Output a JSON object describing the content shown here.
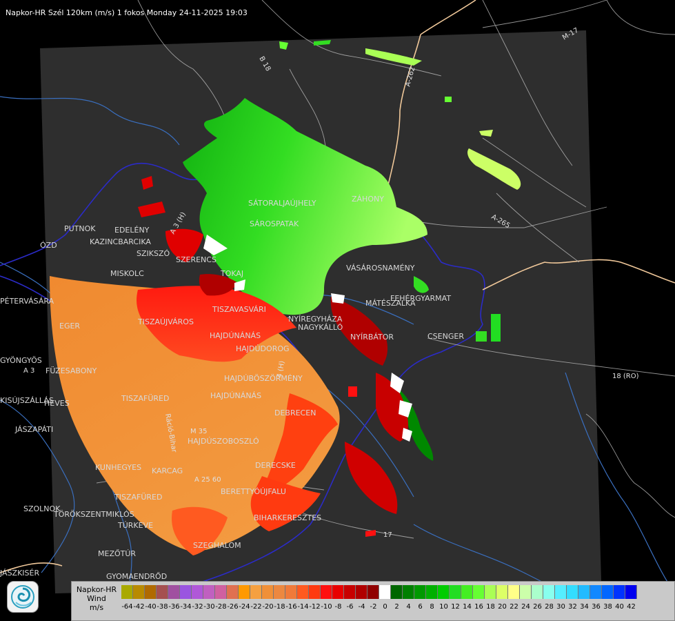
{
  "title": "Napkor-HR Szél 120km (m/s) 1 fokos Monday 24-11-2025 19:03",
  "colors": {
    "background": "#000000",
    "radar_area": "#2e2e2e",
    "border": "#2b2bc8",
    "road": "#f0c89a",
    "river": "#3a6fbf"
  },
  "places": [
    {
      "name": "PUTNOK"
    },
    {
      "name": "EDELÉNY"
    },
    {
      "name": "KAZINCBARCIKA"
    },
    {
      "name": "SZIKSZÓ"
    },
    {
      "name": "SZERENCS"
    },
    {
      "name": "MISKOLC"
    },
    {
      "name": "TOKAJ"
    },
    {
      "name": "SÁTORALJAÚJHELY"
    },
    {
      "name": "SÁROSPATAK"
    },
    {
      "name": "ZÁHONY"
    },
    {
      "name": "VÁSÁROSNAMÉNY"
    },
    {
      "name": "FEHÉRGYARMAT"
    },
    {
      "name": "MÁTÉSZALKA"
    },
    {
      "name": "CSENGER"
    },
    {
      "name": "NYÍRBÁTOR"
    },
    {
      "name": "NYÍREGYHÁZA"
    },
    {
      "name": "NAGYKÁLLÓ"
    },
    {
      "name": "TISZAVASVÁRI"
    },
    {
      "name": "TISZAÚJVÁROS"
    },
    {
      "name": "HAJDÚNÁNÁS"
    },
    {
      "name": "HAJDÚDOROG"
    },
    {
      "name": "HAJDÚBÖSZÖRMÉNY"
    },
    {
      "name": "HAJDÚNÁNÁS"
    },
    {
      "name": "DEBRECEN"
    },
    {
      "name": "HAJDÚSZOBOSZLÓ"
    },
    {
      "name": "DERECSKE"
    },
    {
      "name": "BERETTYÓÚJFALU"
    },
    {
      "name": "BIHARKERESZTES"
    },
    {
      "name": "SZEGHALOM"
    },
    {
      "name": "KARCAG"
    },
    {
      "name": "KUNHEGYES"
    },
    {
      "name": "TISZAFÜRED"
    },
    {
      "name": "EGER"
    },
    {
      "name": "GYÖNGYÖS"
    },
    {
      "name": "HEVES"
    },
    {
      "name": "JÁSZAPÁTI"
    },
    {
      "name": "PÉTERVÁSÁRA"
    },
    {
      "name": "FÜZESABONY"
    },
    {
      "name": "SZOLNOK"
    },
    {
      "name": "TÖRÖKSZENTMIKLÓS"
    },
    {
      "name": "TÚRKEVE"
    },
    {
      "name": "MEZŐTÚR"
    },
    {
      "name": "GYOMAENDRŐD"
    },
    {
      "name": "KISÚJSZÁLLÁS"
    },
    {
      "name": "JÁSZKISÉR"
    },
    {
      "name": "ÓZD"
    },
    {
      "name": "TISZAFÜRED"
    }
  ],
  "roads": [
    {
      "name": "B 18"
    },
    {
      "name": "A-262"
    },
    {
      "name": "M-17"
    },
    {
      "name": "A-265"
    },
    {
      "name": "18 (RO)"
    },
    {
      "name": "A 3"
    },
    {
      "name": "Ráció-Bihar"
    },
    {
      "name": "4 (H)"
    },
    {
      "name": "A 3 (H)"
    },
    {
      "name": "M 35"
    },
    {
      "name": "A 25 60"
    },
    {
      "name": "17"
    }
  ],
  "legend": {
    "line1": "Napkor-HR",
    "line2": "Wind",
    "line3": "m/s",
    "bins": [
      {
        "value": "-64",
        "color": "#a9a900"
      },
      {
        "value": "-42",
        "color": "#b88a00"
      },
      {
        "value": "-40",
        "color": "#b06a00"
      },
      {
        "value": "-38",
        "color": "#a55050"
      },
      {
        "value": "-36",
        "color": "#a050a0"
      },
      {
        "value": "-34",
        "color": "#9a55e0"
      },
      {
        "value": "-32",
        "color": "#b058d8"
      },
      {
        "value": "-30",
        "color": "#c060c0"
      },
      {
        "value": "-28",
        "color": "#d060a0"
      },
      {
        "value": "-26",
        "color": "#e07050"
      },
      {
        "value": "-24",
        "color": "#ff9900"
      },
      {
        "value": "-22",
        "color": "#f5a040"
      },
      {
        "value": "-20",
        "color": "#f09038"
      },
      {
        "value": "-18",
        "color": "#ec8840"
      },
      {
        "value": "-16",
        "color": "#f07a3a"
      },
      {
        "value": "-14",
        "color": "#ff5a20"
      },
      {
        "value": "-12",
        "color": "#ff3a10"
      },
      {
        "value": "-10",
        "color": "#ff1010"
      },
      {
        "value": "-8",
        "color": "#e80000"
      },
      {
        "value": "-6",
        "color": "#c80000"
      },
      {
        "value": "-4",
        "color": "#b00000"
      },
      {
        "value": "-2",
        "color": "#900000"
      },
      {
        "value": "0",
        "color": "#ffffff"
      },
      {
        "value": "2",
        "color": "#006600"
      },
      {
        "value": "4",
        "color": "#008000"
      },
      {
        "value": "6",
        "color": "#009900"
      },
      {
        "value": "8",
        "color": "#00b000"
      },
      {
        "value": "10",
        "color": "#00cc00"
      },
      {
        "value": "12",
        "color": "#22dd22"
      },
      {
        "value": "14",
        "color": "#44ee22"
      },
      {
        "value": "16",
        "color": "#66ff33"
      },
      {
        "value": "18",
        "color": "#aaff55"
      },
      {
        "value": "20",
        "color": "#ddff66"
      },
      {
        "value": "22",
        "color": "#ffff88"
      },
      {
        "value": "24",
        "color": "#ccffaa"
      },
      {
        "value": "26",
        "color": "#aaffcc"
      },
      {
        "value": "28",
        "color": "#88ffee"
      },
      {
        "value": "30",
        "color": "#55eeff"
      },
      {
        "value": "32",
        "color": "#33ddff"
      },
      {
        "value": "34",
        "color": "#22bbff"
      },
      {
        "value": "36",
        "color": "#1188ff"
      },
      {
        "value": "38",
        "color": "#0066ff"
      },
      {
        "value": "40",
        "color": "#0033ff"
      },
      {
        "value": "42",
        "color": "#0000ee"
      }
    ]
  }
}
